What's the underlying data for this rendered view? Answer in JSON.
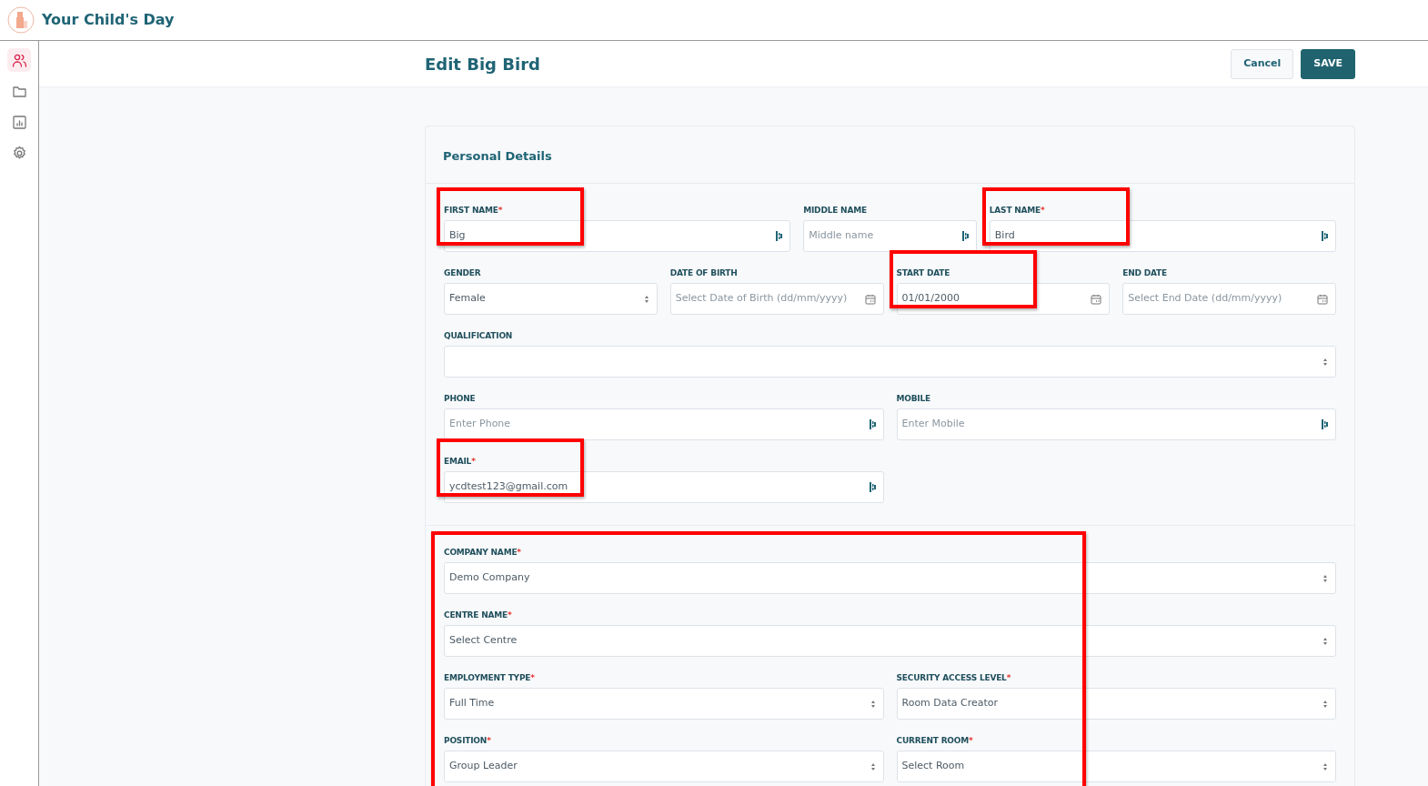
{
  "app": {
    "name": "Your Child's Day"
  },
  "sidebar": {
    "items": [
      {
        "selected": true
      },
      {
        "selected": false
      },
      {
        "selected": false
      },
      {
        "selected": false
      }
    ]
  },
  "page": {
    "title": "Edit Big Bird",
    "buttons": [
      {
        "label": "Cancel",
        "kind": "secondary"
      },
      {
        "label": "SAVE",
        "kind": "primary"
      }
    ]
  },
  "card": {
    "title": "Personal Details",
    "sections": [
      {
        "highlighted": false,
        "rows": [
          [
            {
              "label": "FIRST NAME",
              "required": "*",
              "kind": "text",
              "value": "Big",
              "highlighted": true
            },
            {
              "label": "MIDDLE NAME",
              "kind": "text",
              "placeholder": "Middle name",
              "highlighted": false
            },
            {
              "label": "LAST NAME",
              "required": "*",
              "kind": "text",
              "value": "Bird",
              "highlighted": true
            }
          ],
          [
            {
              "label": "GENDER",
              "kind": "select",
              "value": "Female",
              "highlighted": false
            },
            {
              "label": "DATE OF BIRTH",
              "kind": "date",
              "placeholder": "Select Date of Birth (dd/mm/yyyy)",
              "highlighted": false
            },
            {
              "label": "START DATE",
              "kind": "date",
              "value": "01/01/2000",
              "highlighted": true
            },
            {
              "label": "END DATE",
              "kind": "date",
              "placeholder": "Select End Date (dd/mm/yyyy)",
              "highlighted": false
            }
          ],
          [
            {
              "label": "QUALIFICATION",
              "kind": "select",
              "highlighted": false
            }
          ],
          [
            {
              "label": "PHONE",
              "kind": "text",
              "placeholder": "Enter Phone",
              "highlighted": false
            },
            {
              "label": "MOBILE",
              "kind": "text",
              "placeholder": "Enter Mobile",
              "highlighted": false
            }
          ],
          [
            {
              "label": "EMAIL",
              "required": "*",
              "kind": "text",
              "value": "ycdtest123@gmail.com",
              "highlighted": true
            }
          ]
        ]
      },
      {
        "highlighted": true,
        "rows": [
          [
            {
              "label": "COMPANY NAME",
              "required": "*",
              "kind": "select",
              "value": "Demo Company",
              "highlighted": false
            }
          ],
          [
            {
              "label": "CENTRE NAME",
              "required": "*",
              "kind": "select",
              "value": "Select Centre",
              "highlighted": false
            }
          ],
          [
            {
              "label": "EMPLOYMENT TYPE",
              "required": "*",
              "kind": "select",
              "value": "Full Time",
              "highlighted": false
            },
            {
              "label": "SECURITY ACCESS LEVEL",
              "required": "*",
              "kind": "select",
              "value": "Room Data Creator",
              "highlighted": false
            }
          ],
          [
            {
              "label": "POSITION",
              "required": "*",
              "kind": "select",
              "value": "Group Leader",
              "highlighted": false
            },
            {
              "label": "CURRENT ROOM",
              "required": "*",
              "kind": "select",
              "value": "Select Room",
              "highlighted": false
            }
          ]
        ]
      }
    ]
  }
}
